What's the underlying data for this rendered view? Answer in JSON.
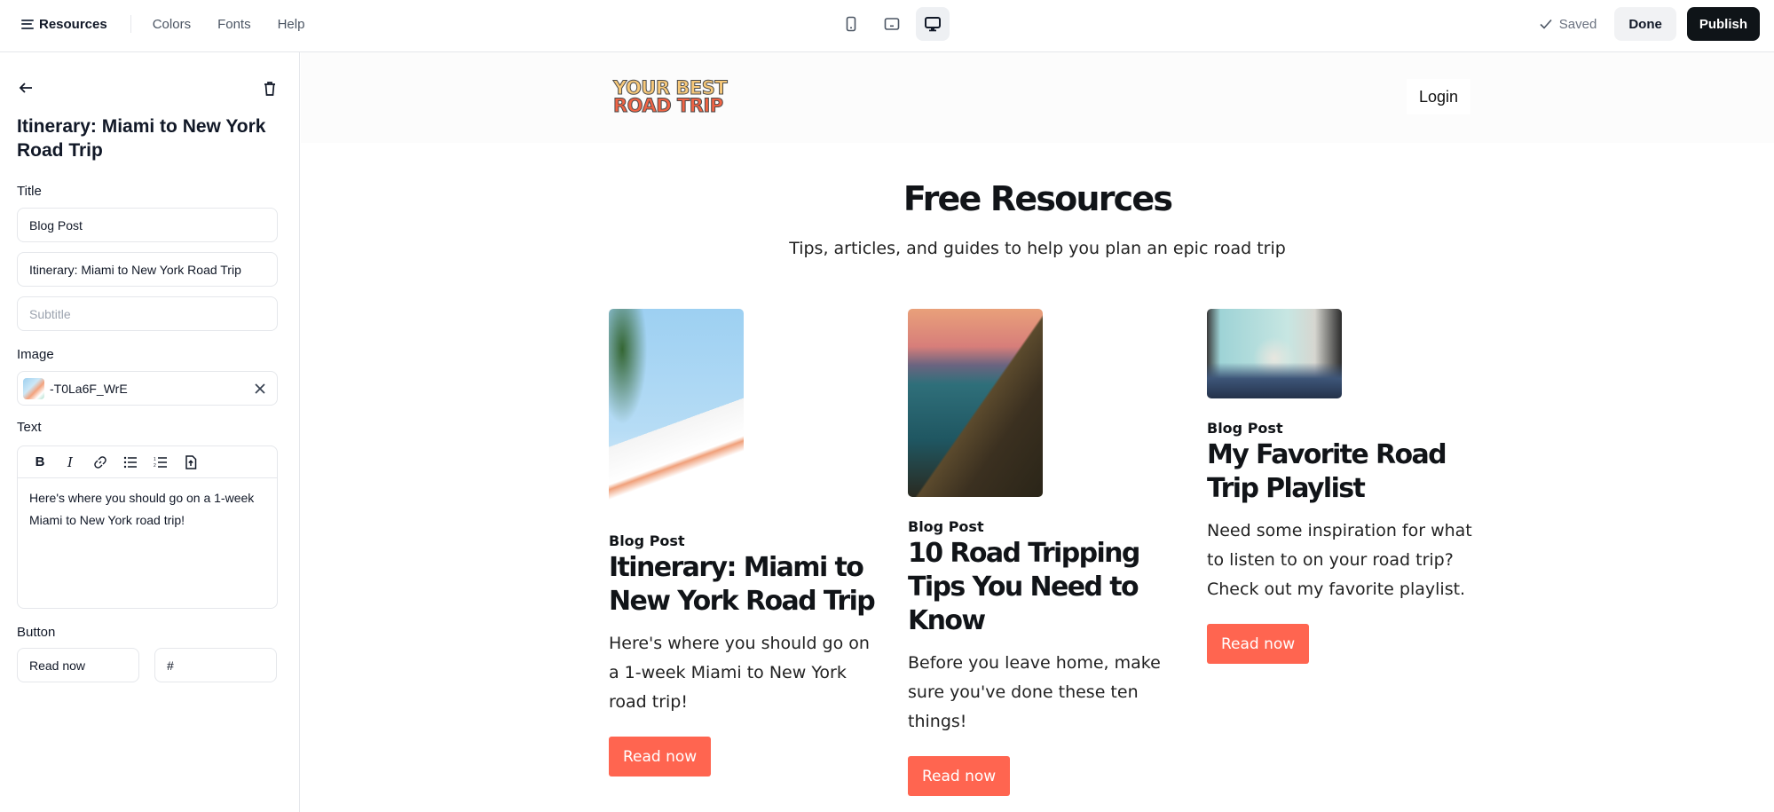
{
  "topbar": {
    "brand": "Resources",
    "brand_icon": "menu-icon",
    "nav_links": [
      "Colors",
      "Fonts",
      "Help"
    ],
    "devices": [
      {
        "name": "mobile",
        "icon": "mobile-icon",
        "active": false
      },
      {
        "name": "tablet",
        "icon": "tablet-icon",
        "active": false
      },
      {
        "name": "desktop",
        "icon": "desktop-icon",
        "active": true
      }
    ],
    "saved_label": "Saved",
    "done_label": "Done",
    "publish_label": "Publish"
  },
  "sidebar": {
    "back_icon": "arrow-left-icon",
    "delete_icon": "trash-icon",
    "heading": "Itinerary: Miami to New York Road Trip",
    "title_label": "Title",
    "category_value": "Blog Post",
    "title_value": "Itinerary: Miami to New York Road Trip",
    "subtitle_placeholder": "Subtitle",
    "image_label": "Image",
    "image_value": "-T0La6F_WrE",
    "text_label": "Text",
    "text_tools": [
      "bold",
      "italic",
      "link",
      "bullet-list",
      "numbered-list",
      "upload-file"
    ],
    "text_value": "Here's where you should go on a 1-week Miami to New York road trip!",
    "button_label": "Button",
    "button_text_value": "Read now",
    "button_link_value": "#"
  },
  "preview": {
    "logo_line1": "YOUR BEST",
    "logo_line2": "ROAD TRIP",
    "login_label": "Login",
    "title": "Free Resources",
    "subtitle": "Tips, articles, and guides to help you plan an epic road trip",
    "accent_color": "#ff6550",
    "cards": [
      {
        "category": "Blog Post",
        "title": "Itinerary: Miami to New York Road Trip",
        "description": "Here's where you should go on a 1-week Miami to New York road trip!",
        "button": "Read now",
        "image": "miami-art-deco-building-photo"
      },
      {
        "category": "Blog Post",
        "title": "10 Road Tripping Tips You Need to Know",
        "description": "Before you leave home, make sure you've done these ten things!",
        "button": "Read now",
        "image": "coastal-road-sunset-photo"
      },
      {
        "category": "Blog Post",
        "title": "My Favorite Road Trip Playlist",
        "description": "Need some inspiration for what to listen to on your road trip? Check out my favorite playlist.",
        "button": "Read now",
        "image": "feet-on-dashboard-photo"
      }
    ]
  }
}
